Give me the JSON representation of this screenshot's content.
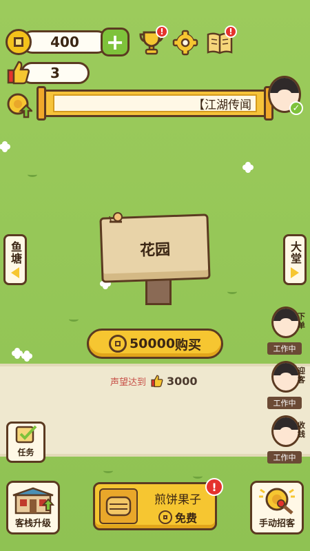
{
  "currency": {
    "coins": "400"
  },
  "reputation": {
    "likes": "3"
  },
  "banner": {
    "text": "【江湖传闻"
  },
  "left_tab": {
    "label": "鱼塘"
  },
  "right_tab": {
    "label": "大堂"
  },
  "location": {
    "name": "花园"
  },
  "purchase": {
    "price": "50000",
    "action": "购买"
  },
  "requirement": {
    "label": "声望达到",
    "value": "3000"
  },
  "staff": [
    {
      "role": "下单",
      "status": "工作中"
    },
    {
      "role": "迎客",
      "status": "工作中"
    },
    {
      "role": "收钱",
      "status": "工作中"
    }
  ],
  "task": {
    "label": "任务"
  },
  "bottom": {
    "upgrade_label": "客栈升级",
    "food_name": "煎饼果子",
    "food_price": "免费",
    "recruit_label": "手动招客"
  },
  "badges": {
    "mark": "!"
  },
  "colors": {
    "gold": "#f6c631",
    "outline": "#5b3a21",
    "grass": "#93c556",
    "alert": "#e5322d",
    "green": "#7ec23b"
  }
}
